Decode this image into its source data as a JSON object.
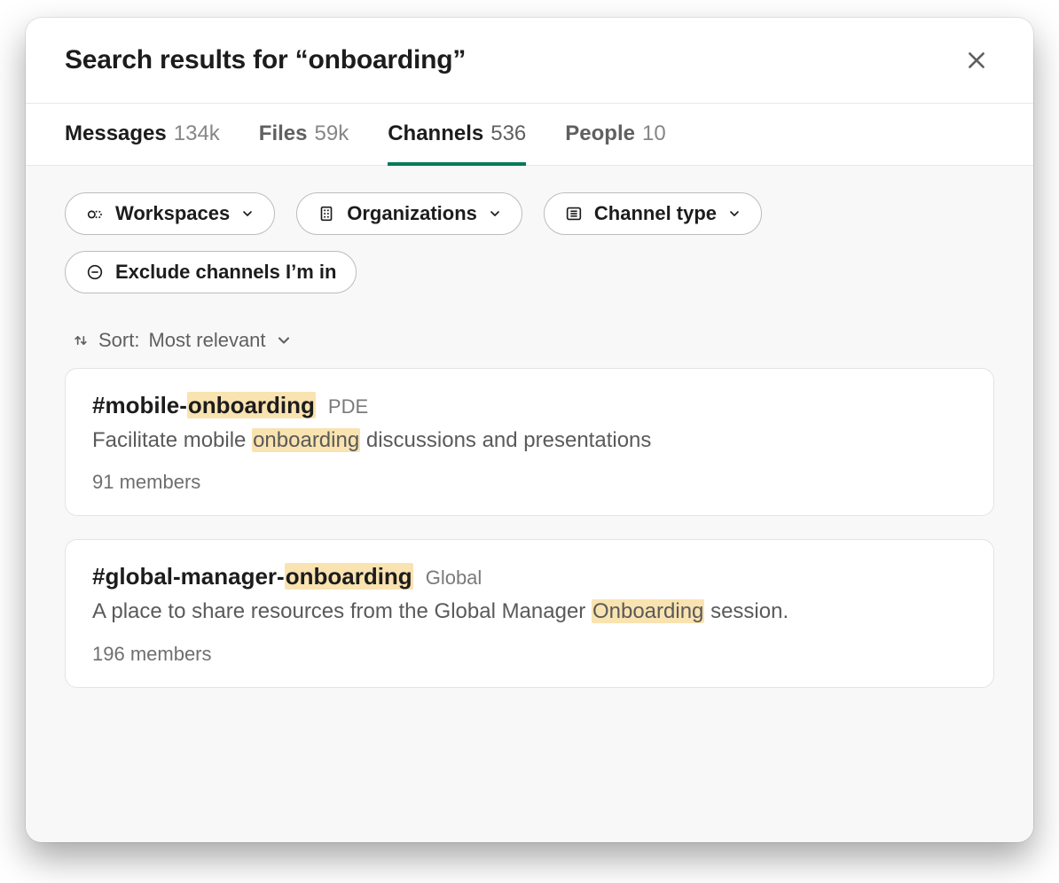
{
  "header": {
    "title": "Search results for “onboarding”"
  },
  "tabs": [
    {
      "label": "Messages",
      "count": "134k",
      "active": false
    },
    {
      "label": "Files",
      "count": "59k",
      "active": false
    },
    {
      "label": "Channels",
      "count": "536",
      "active": true
    },
    {
      "label": "People",
      "count": "10",
      "active": false
    }
  ],
  "filters": {
    "workspaces": "Workspaces",
    "organizations": "Organizations",
    "channel_type": "Channel type",
    "exclude": "Exclude channels I’m in"
  },
  "sort": {
    "prefix": "Sort:",
    "value": "Most relevant"
  },
  "results": [
    {
      "name_prefix": "#mobile-",
      "name_highlight": "onboarding",
      "name_suffix": "",
      "tag": "PDE",
      "desc_prefix": "Facilitate mobile ",
      "desc_highlight": "onboarding",
      "desc_suffix": " discussions and presentations",
      "members": "91 members"
    },
    {
      "name_prefix": "#global-manager-",
      "name_highlight": "onboarding",
      "name_suffix": "",
      "tag": "Global",
      "desc_prefix": "A place to share resources from the Global Manager ",
      "desc_highlight": "Onboarding",
      "desc_suffix": " session.",
      "members": "196 members"
    }
  ]
}
